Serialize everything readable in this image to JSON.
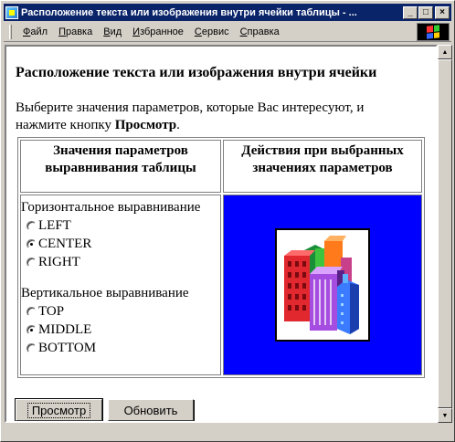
{
  "window": {
    "title": "Расположение текста или изображения внутри ячейки таблицы - ...",
    "controls": {
      "minimize": "_",
      "maximize": "□",
      "close": "×"
    }
  },
  "menu": {
    "items": [
      {
        "ul": "Ф",
        "rest": "айл"
      },
      {
        "ul": "П",
        "rest": "равка"
      },
      {
        "ul": "В",
        "rest": "ид"
      },
      {
        "ul": "И",
        "rest": "збранное"
      },
      {
        "ul": "С",
        "rest": "ервис"
      },
      {
        "ul": "С",
        "rest": "правка"
      }
    ]
  },
  "page": {
    "heading": "Расположение текста или изображения внутри ячейки",
    "intro_text": "Выберите значения параметров, которые Вас интересуют, и нажмите кнопку ",
    "intro_bold": "Просмотр",
    "intro_end": ".",
    "table": {
      "col1_header": "Значения параметров выравнивания таблицы",
      "col2_header": "Действия при выбранных значениях параметров",
      "horizontal_label": "Горизонтальное выравнивание",
      "horizontal_options": [
        "LEFT",
        "CENTER",
        "RIGHT"
      ],
      "horizontal_selected": "CENTER",
      "vertical_label": "Вертикальное выравнивание",
      "vertical_options": [
        "TOP",
        "MIDDLE",
        "BOTTOM"
      ],
      "vertical_selected": "MIDDLE"
    },
    "buttons": {
      "view": "Просмотр",
      "reset": "Обновить"
    }
  },
  "colors": {
    "titlebar": "#0a246a",
    "preview_bg": "#0000ff",
    "chrome": "#d4d0c8"
  },
  "icons": [
    "ie-page-icon",
    "windows-flag-icon",
    "buildings-clipart-icon"
  ]
}
